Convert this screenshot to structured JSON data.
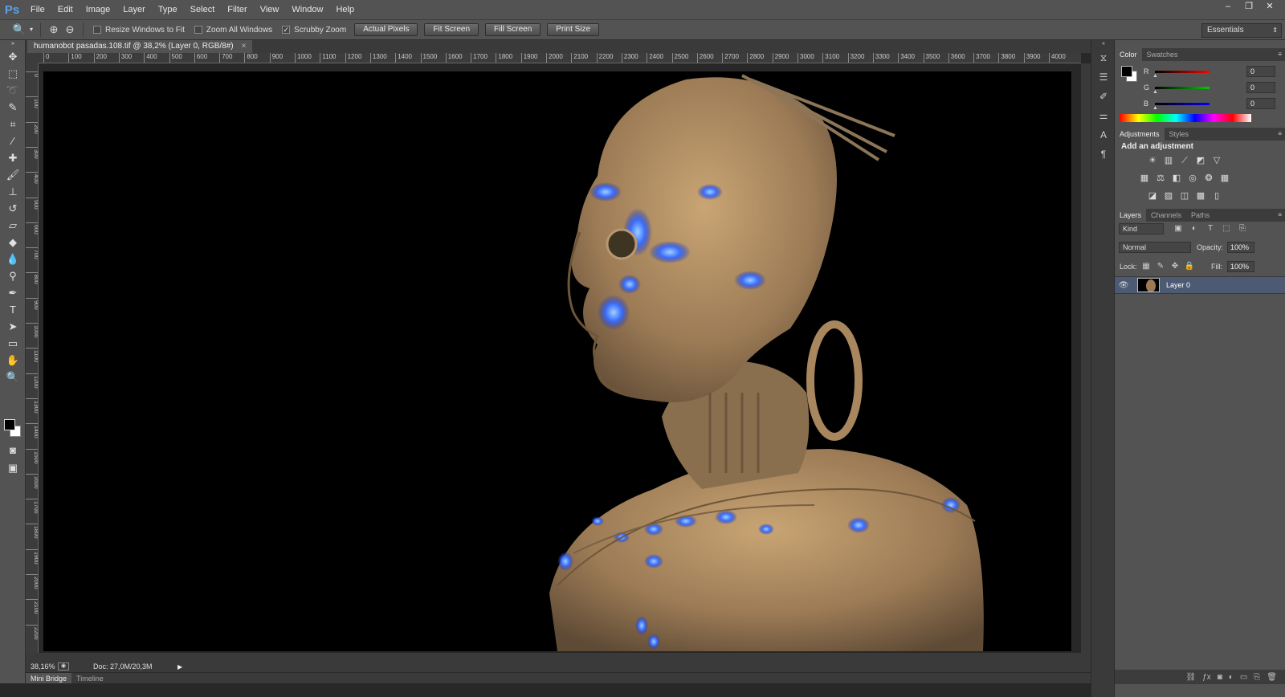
{
  "app": {
    "logo": "Ps"
  },
  "menu": [
    "File",
    "Edit",
    "Image",
    "Layer",
    "Type",
    "Select",
    "Filter",
    "View",
    "Window",
    "Help"
  ],
  "window_controls": {
    "minimize": "–",
    "restore": "❐",
    "close": "✕"
  },
  "options": {
    "resize_windows": "Resize Windows to Fit",
    "zoom_all": "Zoom All Windows",
    "scrubby_zoom": "Scrubby Zoom",
    "scrubby_checked": "✓",
    "actual_pixels": "Actual Pixels",
    "fit_screen": "Fit Screen",
    "fill_screen": "Fill Screen",
    "print_size": "Print Size",
    "workspace": "Essentials"
  },
  "document": {
    "tab_title": "humanobot pasadas.108.tif @ 38,2% (Layer 0, RGB/8#)",
    "close": "×",
    "zoom": "38,16%",
    "doc_size": "Doc: 27,0M/20,3M",
    "arrow": "▶"
  },
  "ruler": {
    "h_ticks": [
      "0",
      "100",
      "200",
      "300",
      "400",
      "500",
      "600",
      "700",
      "800",
      "900",
      "1000",
      "1100",
      "1200",
      "1300",
      "1400",
      "1500",
      "1600",
      "1700",
      "1800",
      "1900",
      "2000",
      "2100",
      "2200",
      "2300",
      "2400",
      "2500",
      "2600",
      "2700",
      "2800",
      "2900",
      "3000",
      "3100",
      "3200",
      "3300",
      "3400",
      "3500",
      "3600",
      "3700",
      "3800",
      "3900",
      "4000"
    ],
    "v_ticks": [
      "0",
      "100",
      "200",
      "300",
      "400",
      "500",
      "600",
      "700",
      "800",
      "900",
      "1000",
      "1100",
      "1200",
      "1300",
      "1400",
      "1500",
      "1600",
      "1700",
      "1800",
      "1900",
      "2000",
      "2100",
      "2200"
    ]
  },
  "bottom_tabs": [
    "Mini Bridge",
    "Timeline"
  ],
  "color_panel": {
    "tabs": [
      "Color",
      "Swatches"
    ],
    "r_label": "R",
    "g_label": "G",
    "b_label": "B",
    "r": "0",
    "g": "0",
    "b": "0"
  },
  "adjustments_panel": {
    "tabs": [
      "Adjustments",
      "Styles"
    ],
    "title": "Add an adjustment"
  },
  "layers_panel": {
    "tabs": [
      "Layers",
      "Channels",
      "Paths"
    ],
    "filter": "Kind",
    "blend_mode": "Normal",
    "opacity_label": "Opacity:",
    "opacity": "100%",
    "lock_label": "Lock:",
    "fill_label": "Fill:",
    "fill": "100%",
    "layer_name": "Layer 0"
  },
  "colors": {
    "panel": "#535353",
    "selected_layer": "#4c5a74",
    "accent": "#5ea0e8"
  }
}
